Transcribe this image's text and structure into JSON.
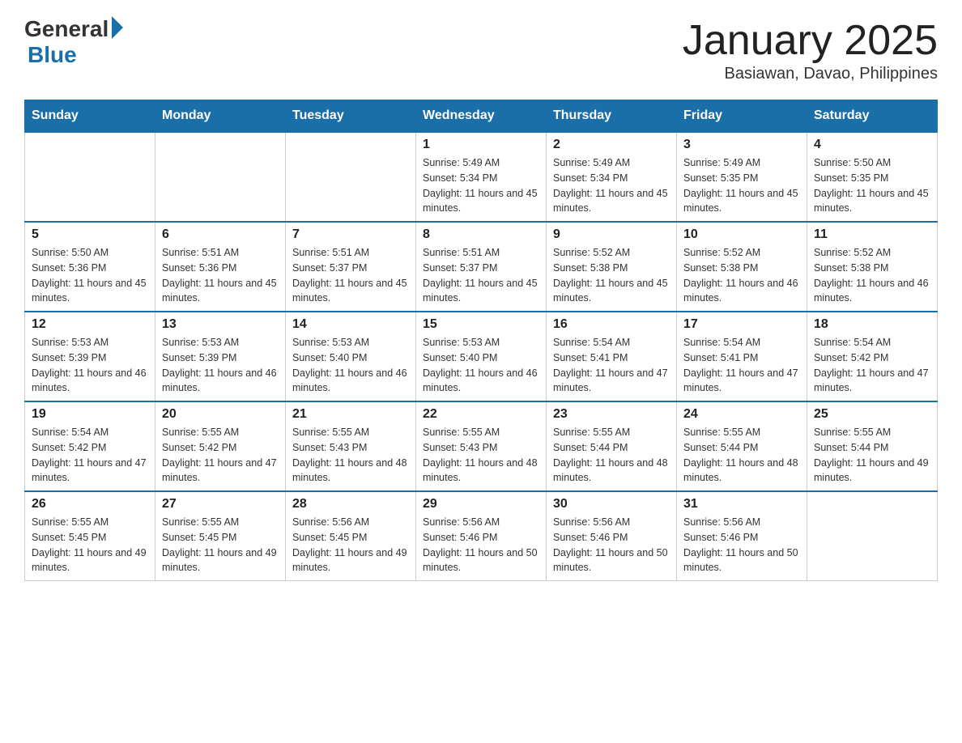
{
  "logo": {
    "general": "General",
    "blue": "Blue"
  },
  "title": "January 2025",
  "location": "Basiawan, Davao, Philippines",
  "days_of_week": [
    "Sunday",
    "Monday",
    "Tuesday",
    "Wednesday",
    "Thursday",
    "Friday",
    "Saturday"
  ],
  "weeks": [
    [
      {
        "day": "",
        "info": ""
      },
      {
        "day": "",
        "info": ""
      },
      {
        "day": "",
        "info": ""
      },
      {
        "day": "1",
        "info": "Sunrise: 5:49 AM\nSunset: 5:34 PM\nDaylight: 11 hours and 45 minutes."
      },
      {
        "day": "2",
        "info": "Sunrise: 5:49 AM\nSunset: 5:34 PM\nDaylight: 11 hours and 45 minutes."
      },
      {
        "day": "3",
        "info": "Sunrise: 5:49 AM\nSunset: 5:35 PM\nDaylight: 11 hours and 45 minutes."
      },
      {
        "day": "4",
        "info": "Sunrise: 5:50 AM\nSunset: 5:35 PM\nDaylight: 11 hours and 45 minutes."
      }
    ],
    [
      {
        "day": "5",
        "info": "Sunrise: 5:50 AM\nSunset: 5:36 PM\nDaylight: 11 hours and 45 minutes."
      },
      {
        "day": "6",
        "info": "Sunrise: 5:51 AM\nSunset: 5:36 PM\nDaylight: 11 hours and 45 minutes."
      },
      {
        "day": "7",
        "info": "Sunrise: 5:51 AM\nSunset: 5:37 PM\nDaylight: 11 hours and 45 minutes."
      },
      {
        "day": "8",
        "info": "Sunrise: 5:51 AM\nSunset: 5:37 PM\nDaylight: 11 hours and 45 minutes."
      },
      {
        "day": "9",
        "info": "Sunrise: 5:52 AM\nSunset: 5:38 PM\nDaylight: 11 hours and 45 minutes."
      },
      {
        "day": "10",
        "info": "Sunrise: 5:52 AM\nSunset: 5:38 PM\nDaylight: 11 hours and 46 minutes."
      },
      {
        "day": "11",
        "info": "Sunrise: 5:52 AM\nSunset: 5:38 PM\nDaylight: 11 hours and 46 minutes."
      }
    ],
    [
      {
        "day": "12",
        "info": "Sunrise: 5:53 AM\nSunset: 5:39 PM\nDaylight: 11 hours and 46 minutes."
      },
      {
        "day": "13",
        "info": "Sunrise: 5:53 AM\nSunset: 5:39 PM\nDaylight: 11 hours and 46 minutes."
      },
      {
        "day": "14",
        "info": "Sunrise: 5:53 AM\nSunset: 5:40 PM\nDaylight: 11 hours and 46 minutes."
      },
      {
        "day": "15",
        "info": "Sunrise: 5:53 AM\nSunset: 5:40 PM\nDaylight: 11 hours and 46 minutes."
      },
      {
        "day": "16",
        "info": "Sunrise: 5:54 AM\nSunset: 5:41 PM\nDaylight: 11 hours and 47 minutes."
      },
      {
        "day": "17",
        "info": "Sunrise: 5:54 AM\nSunset: 5:41 PM\nDaylight: 11 hours and 47 minutes."
      },
      {
        "day": "18",
        "info": "Sunrise: 5:54 AM\nSunset: 5:42 PM\nDaylight: 11 hours and 47 minutes."
      }
    ],
    [
      {
        "day": "19",
        "info": "Sunrise: 5:54 AM\nSunset: 5:42 PM\nDaylight: 11 hours and 47 minutes."
      },
      {
        "day": "20",
        "info": "Sunrise: 5:55 AM\nSunset: 5:42 PM\nDaylight: 11 hours and 47 minutes."
      },
      {
        "day": "21",
        "info": "Sunrise: 5:55 AM\nSunset: 5:43 PM\nDaylight: 11 hours and 48 minutes."
      },
      {
        "day": "22",
        "info": "Sunrise: 5:55 AM\nSunset: 5:43 PM\nDaylight: 11 hours and 48 minutes."
      },
      {
        "day": "23",
        "info": "Sunrise: 5:55 AM\nSunset: 5:44 PM\nDaylight: 11 hours and 48 minutes."
      },
      {
        "day": "24",
        "info": "Sunrise: 5:55 AM\nSunset: 5:44 PM\nDaylight: 11 hours and 48 minutes."
      },
      {
        "day": "25",
        "info": "Sunrise: 5:55 AM\nSunset: 5:44 PM\nDaylight: 11 hours and 49 minutes."
      }
    ],
    [
      {
        "day": "26",
        "info": "Sunrise: 5:55 AM\nSunset: 5:45 PM\nDaylight: 11 hours and 49 minutes."
      },
      {
        "day": "27",
        "info": "Sunrise: 5:55 AM\nSunset: 5:45 PM\nDaylight: 11 hours and 49 minutes."
      },
      {
        "day": "28",
        "info": "Sunrise: 5:56 AM\nSunset: 5:45 PM\nDaylight: 11 hours and 49 minutes."
      },
      {
        "day": "29",
        "info": "Sunrise: 5:56 AM\nSunset: 5:46 PM\nDaylight: 11 hours and 50 minutes."
      },
      {
        "day": "30",
        "info": "Sunrise: 5:56 AM\nSunset: 5:46 PM\nDaylight: 11 hours and 50 minutes."
      },
      {
        "day": "31",
        "info": "Sunrise: 5:56 AM\nSunset: 5:46 PM\nDaylight: 11 hours and 50 minutes."
      },
      {
        "day": "",
        "info": ""
      }
    ]
  ]
}
